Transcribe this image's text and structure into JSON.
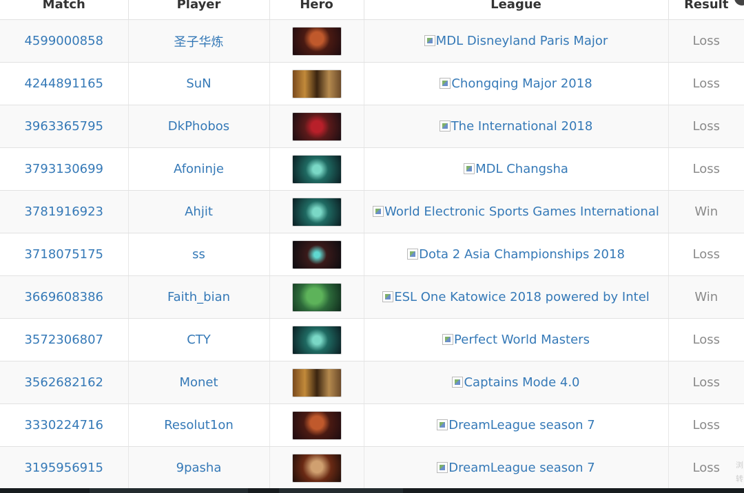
{
  "table": {
    "headers": {
      "match": "Match",
      "player": "Player",
      "hero": "Hero",
      "league": "League",
      "result": "Result"
    },
    "rows": [
      {
        "match": "4599000858",
        "player": "圣子华炼",
        "hero_icon": "terrorblade-portrait",
        "league": "MDL Disneyland Paris Major",
        "result": "Loss"
      },
      {
        "match": "4244891165",
        "player": "SuN",
        "hero_icon": "hero-portrait-pair",
        "league": "Chongqing Major 2018",
        "result": "Loss"
      },
      {
        "match": "3963365795",
        "player": "DkPhobos",
        "hero_icon": "broodmother-portrait",
        "league": "The International 2018",
        "result": "Loss"
      },
      {
        "match": "3793130699",
        "player": "Afoninje",
        "hero_icon": "wraith-portrait",
        "league": "MDL Changsha",
        "result": "Loss"
      },
      {
        "match": "3781916923",
        "player": "Ahjit",
        "hero_icon": "wraith-portrait",
        "league": "World Electronic Sports Games International",
        "result": "Win"
      },
      {
        "match": "3718075175",
        "player": "ss",
        "hero_icon": "dark-hero-portrait",
        "league": "Dota 2 Asia Championships 2018",
        "result": "Loss"
      },
      {
        "match": "3669608386",
        "player": "Faith_bian",
        "hero_icon": "tidehunter-portrait",
        "league": "ESL One Katowice 2018 powered by Intel",
        "result": "Win"
      },
      {
        "match": "3572306807",
        "player": "CTY",
        "hero_icon": "wraith-portrait",
        "league": "Perfect World Masters",
        "result": "Loss"
      },
      {
        "match": "3562682162",
        "player": "Monet",
        "hero_icon": "hero-portrait-pair",
        "league": "Captains Mode 4.0",
        "result": "Loss"
      },
      {
        "match": "3330224716",
        "player": "Resolut1on",
        "hero_icon": "terrorblade-portrait",
        "league": "DreamLeague season 7",
        "result": "Loss"
      },
      {
        "match": "3195956915",
        "player": "9pasha",
        "hero_icon": "beast-hero-portrait",
        "league": "DreamLeague season 7",
        "result": "Loss"
      }
    ]
  },
  "side_text": "浏 转",
  "colors": {
    "link": "#3579b7",
    "result_text": "#8a8a8a",
    "row_stripe": "#f9f9f9",
    "border": "#e2e2e2",
    "taskbar": "#171c1f"
  }
}
